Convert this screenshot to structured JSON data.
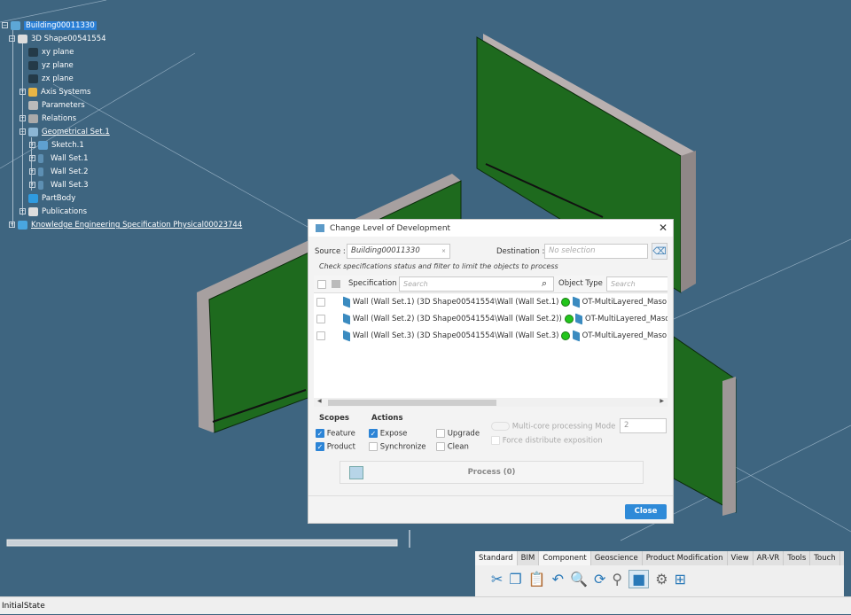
{
  "tree": {
    "root": "Building00011330",
    "shape": "3D Shape00541554",
    "items": [
      "xy plane",
      "yz plane",
      "zx plane",
      "Axis Systems",
      "Parameters",
      "Relations",
      "Geometrical Set.1",
      "Sketch.1",
      "Wall Set.1",
      "Wall Set.2",
      "Wall Set.3",
      "PartBody",
      "Publications"
    ],
    "kes": "Knowledge Engineering Specification Physical00023744"
  },
  "dialog": {
    "title": "Change Level of Development",
    "source_label": "Source :",
    "source_value": "Building00011330",
    "source_clear": "×",
    "destination_label": "Destination :",
    "destination_placeholder": "No selection",
    "hint": "Check specifications status and filter to limit the objects to process",
    "col_spec": "Specification",
    "col_type": "Object Type",
    "search_placeholder": "Search",
    "rows": [
      {
        "spec": "Wall (Wall Set.1) (3D Shape00541554\\Wall (Wall Set.1)",
        "type": "OT-MultiLayered_Maso"
      },
      {
        "spec": "Wall (Wall Set.2) (3D Shape00541554\\Wall (Wall Set.2))",
        "type": "OT-MultiLayered_Maso"
      },
      {
        "spec": "Wall (Wall Set.3) (3D Shape00541554\\Wall (Wall Set.3)",
        "type": "OT-MultiLayered_Maso"
      }
    ],
    "scopes_label": "Scopes",
    "actions_label": "Actions",
    "feature": "Feature",
    "product": "Product",
    "expose": "Expose",
    "synchronize": "Synchronize",
    "upgrade": "Upgrade",
    "clean": "Clean",
    "multicore": "Multi-core processing Mode",
    "multicore_value": "2",
    "force": "Force distribute exposition",
    "process": "Process (0)",
    "close": "Close"
  },
  "toolbar": {
    "tabs": [
      "Standard",
      "BIM",
      "Component",
      "Geoscience",
      "Product Modification",
      "View",
      "AR-VR",
      "Tools",
      "Touch"
    ]
  },
  "status": "InitialState"
}
